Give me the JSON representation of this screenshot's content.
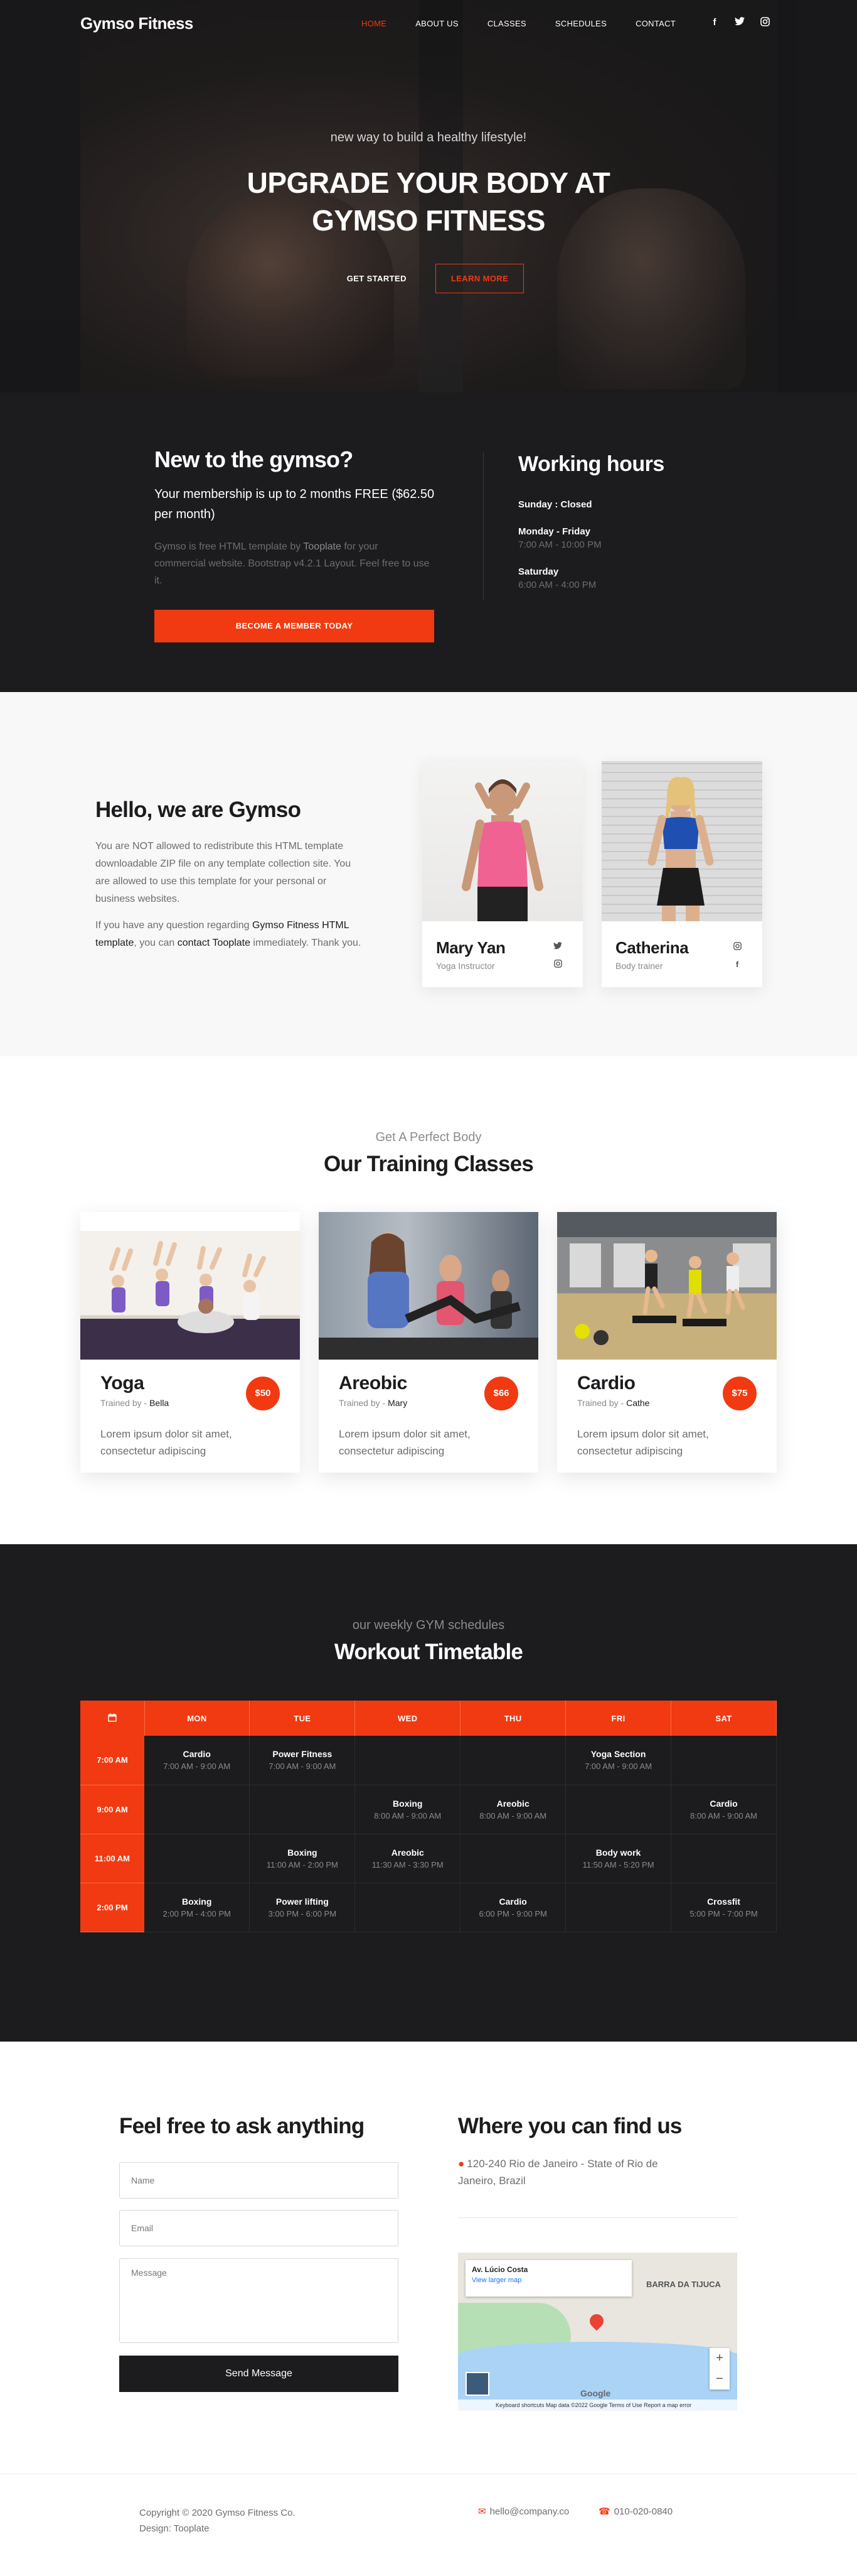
{
  "brand": "Gymso Fitness",
  "nav": {
    "items": [
      {
        "label": "HOME",
        "active": true
      },
      {
        "label": "ABOUT US"
      },
      {
        "label": "CLASSES"
      },
      {
        "label": "SCHEDULES"
      },
      {
        "label": "CONTACT"
      }
    ],
    "social": [
      "facebook-icon",
      "twitter-icon",
      "instagram-icon"
    ]
  },
  "hero": {
    "subtitle": "new way to build a healthy lifestyle!",
    "title_line1": "UPGRADE YOUR BODY AT",
    "title_line2": "GYMSO FITNESS",
    "btn_start": "GET STARTED",
    "btn_learn": "LEARN MORE"
  },
  "info": {
    "title": "New to the gymso?",
    "lead": "Your membership is up to 2 months FREE ($62.50 per month)",
    "desc_before": "Gymso is free HTML template by ",
    "desc_link": "Tooplate",
    "desc_after": " for your commercial website. Bootstrap v4.2.1 Layout. Feel free to use it.",
    "cta": "BECOME A MEMBER TODAY",
    "hours_title": "Working hours",
    "hours": [
      {
        "day": "Sunday : Closed",
        "time": ""
      },
      {
        "day": "Monday - Friday",
        "time": "7:00 AM - 10:00 PM"
      },
      {
        "day": "Saturday",
        "time": "6:00 AM - 4:00 PM"
      }
    ]
  },
  "about": {
    "title": "Hello, we are Gymso",
    "p1": "You are NOT allowed to redistribute this HTML template downloadable ZIP file on any template collection site. You are allowed to use this template for your personal or business websites.",
    "p2_a": "If you have any question regarding ",
    "p2_b": "Gymso Fitness HTML template",
    "p2_c": ", you can ",
    "p2_d": "contact Tooplate",
    "p2_e": " immediately. Thank you.",
    "trainers": [
      {
        "name": "Mary Yan",
        "role": "Yoga Instructor"
      },
      {
        "name": "Catherina",
        "role": "Body trainer"
      }
    ]
  },
  "classes": {
    "subtitle": "Get A Perfect Body",
    "title": "Our Training Classes",
    "items": [
      {
        "name": "Yoga",
        "trainer_label": "Trained by",
        "trainer": "Bella",
        "price": "$50",
        "text": "Lorem ipsum dolor sit amet, consectetur adipiscing"
      },
      {
        "name": "Areobic",
        "trainer_label": "Trained by",
        "trainer": "Mary",
        "price": "$66",
        "text": "Lorem ipsum dolor sit amet, consectetur adipiscing"
      },
      {
        "name": "Cardio",
        "trainer_label": "Trained by",
        "trainer": "Cathe",
        "price": "$75",
        "text": "Lorem ipsum dolor sit amet, consectetur adipiscing"
      }
    ]
  },
  "timetable": {
    "subtitle": "our weekly GYM schedules",
    "title": "Workout Timetable",
    "days": [
      "MON",
      "TUE",
      "WED",
      "THU",
      "FRI",
      "SAT"
    ],
    "rows": [
      {
        "time": "7:00 AM",
        "cells": [
          {
            "n": "Cardio",
            "h": "7:00 AM - 9:00 AM"
          },
          {
            "n": "Power Fitness",
            "h": "7:00 AM - 9:00 AM"
          },
          null,
          null,
          {
            "n": "Yoga Section",
            "h": "7:00 AM - 9:00 AM"
          },
          null
        ]
      },
      {
        "time": "9:00 AM",
        "cells": [
          null,
          null,
          {
            "n": "Boxing",
            "h": "8:00 AM - 9:00 AM"
          },
          {
            "n": "Areobic",
            "h": "8:00 AM - 9:00 AM"
          },
          null,
          {
            "n": "Cardio",
            "h": "8:00 AM - 9:00 AM"
          }
        ]
      },
      {
        "time": "11:00 AM",
        "cells": [
          null,
          {
            "n": "Boxing",
            "h": "11:00 AM - 2:00 PM"
          },
          {
            "n": "Areobic",
            "h": "11:30 AM - 3:30 PM"
          },
          null,
          {
            "n": "Body work",
            "h": "11:50 AM - 5:20 PM"
          },
          null
        ]
      },
      {
        "time": "2:00 PM",
        "cells": [
          {
            "n": "Boxing",
            "h": "2:00 PM - 4:00 PM"
          },
          {
            "n": "Power lifting",
            "h": "3:00 PM - 6:00 PM"
          },
          null,
          {
            "n": "Cardio",
            "h": "6:00 PM - 9:00 PM"
          },
          null,
          {
            "n": "Crossfit",
            "h": "5:00 PM - 7:00 PM"
          }
        ]
      }
    ]
  },
  "contact": {
    "title": "Feel free to ask anything",
    "name_placeholder": "Name",
    "email_placeholder": "Email",
    "message_placeholder": "Message",
    "send": "Send Message",
    "find_title": "Where you can find us",
    "address": "120-240 Rio de Janeiro - State of Rio de Janeiro, Brazil",
    "map": {
      "card_title": "Av. Lúcio Costa",
      "card_link": "View larger map",
      "label": "BARRA DA TIJUCA",
      "google": "Google",
      "footer": "Keyboard shortcuts   Map data ©2022 Google   Terms of Use   Report a map error"
    }
  },
  "footer": {
    "copyright": "Copyright © 2020 Gymso Fitness Co.",
    "design": "Design: Tooplate",
    "email": "hello@company.co",
    "phone": "010-020-0840"
  },
  "colors": {
    "accent": "#f13a11",
    "dark": "#1c1c1f"
  }
}
